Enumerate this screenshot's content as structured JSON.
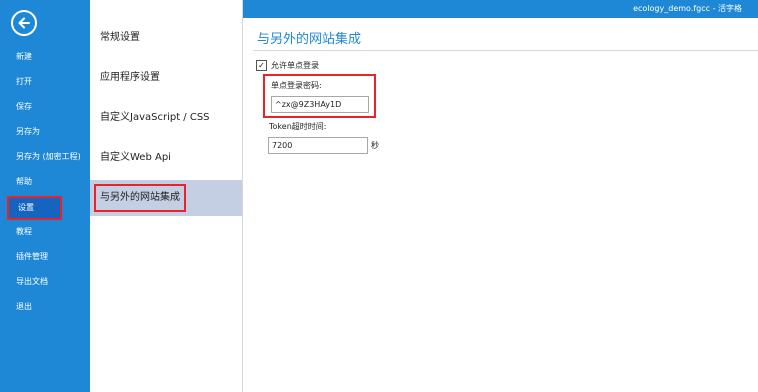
{
  "window": {
    "title": "ecology_demo.fgcc - 活字格"
  },
  "backstage": {
    "items": [
      {
        "label": "新建"
      },
      {
        "label": "打开"
      },
      {
        "label": "保存"
      },
      {
        "label": "另存为"
      },
      {
        "label": "另存为 (加密工程)"
      },
      {
        "label": "帮助"
      },
      {
        "label": "设置"
      },
      {
        "label": "教程"
      },
      {
        "label": "插件管理"
      },
      {
        "label": "导出文档"
      },
      {
        "label": "退出"
      }
    ],
    "selected": "设置"
  },
  "settings_nav": {
    "items": [
      {
        "label": "常规设置"
      },
      {
        "label": "应用程序设置"
      },
      {
        "label": "自定义JavaScript / CSS"
      },
      {
        "label": "自定义Web Api"
      },
      {
        "label": "与另外的网站集成"
      }
    ],
    "active": "与另外的网站集成"
  },
  "panel": {
    "title": "与另外的网站集成",
    "allow_sso_label": "允许单点登录",
    "allow_sso_checked": true,
    "sso_password_label": "单点登录密码:",
    "sso_password_value": "^zx@9Z3HAy1D",
    "token_timeout_label": "Token超时时间:",
    "token_timeout_value": "7200",
    "token_timeout_unit": "秒"
  },
  "colors": {
    "accent": "#1e88d6",
    "highlight_border": "#e8232a",
    "active_nav_bg": "#c5cfe3"
  }
}
